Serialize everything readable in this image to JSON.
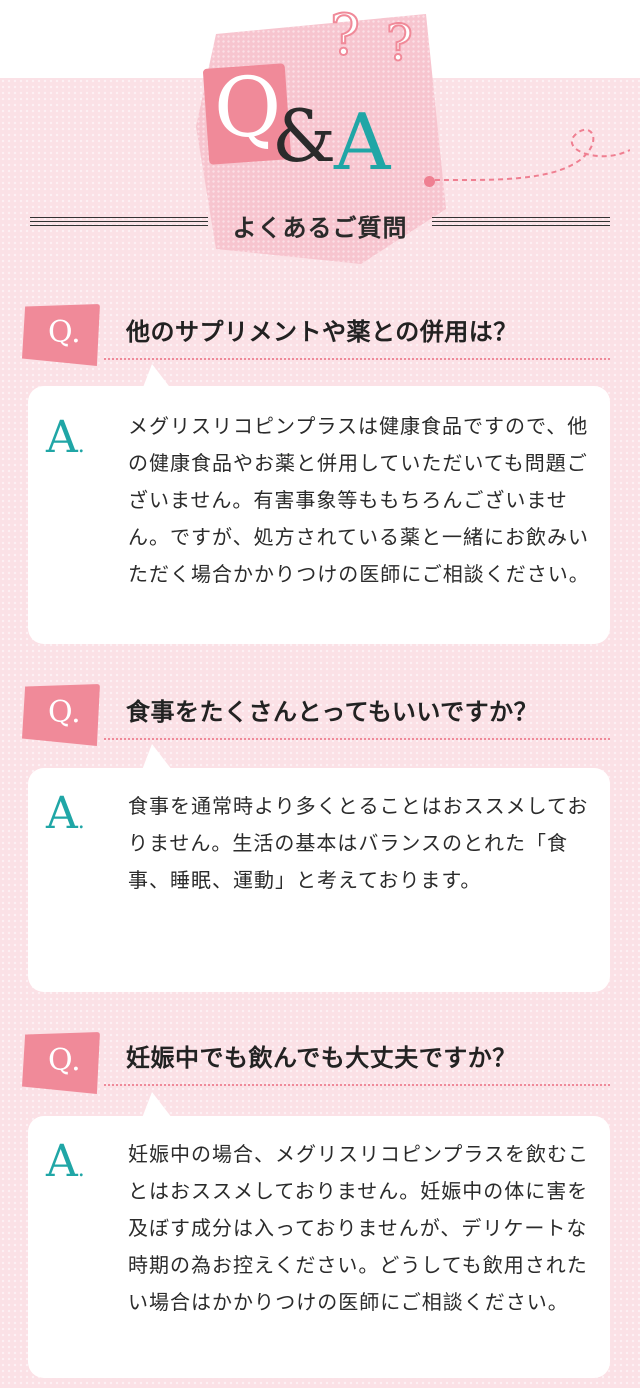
{
  "header": {
    "logo_q": "Q",
    "logo_amp": "&",
    "logo_a": "A",
    "qmark": "?",
    "subtitle": "よくあるご質問"
  },
  "faq": [
    {
      "q_label": "Q.",
      "question": "他のサプリメントや薬との併用は？",
      "a_label": "A",
      "answer": "メグリスリコピンプラスは健康食品ですので、他の健康食品やお薬と併用していただいても問題ございません。有害事象等ももちろんございません。ですが、処方されている薬と一緒にお飲みいただく場合かかりつけの医師にご相談ください。"
    },
    {
      "q_label": "Q.",
      "question": "食事をたくさんとってもいいですか？",
      "a_label": "A",
      "answer": "食事を通常時より多くとることはおススメしておりません。生活の基本はバランスのとれた「食事、睡眠、運動」と考えております。"
    },
    {
      "q_label": "Q.",
      "question": "妊娠中でも飲んでも大丈夫ですか？",
      "a_label": "A",
      "answer": "妊娠中の場合、メグリスリコピンプラスを飲むことはおススメしておりません。妊娠中の体に害を及ぼす成分は入っておりませんが、デリケートな時期の為お控えください。どうしても飲用されたい場合はかかりつけの医師にご相談ください。"
    }
  ],
  "colors": {
    "accent_pink": "#f08a99",
    "accent_teal": "#20a6a6",
    "background": "#fbe1e6"
  }
}
